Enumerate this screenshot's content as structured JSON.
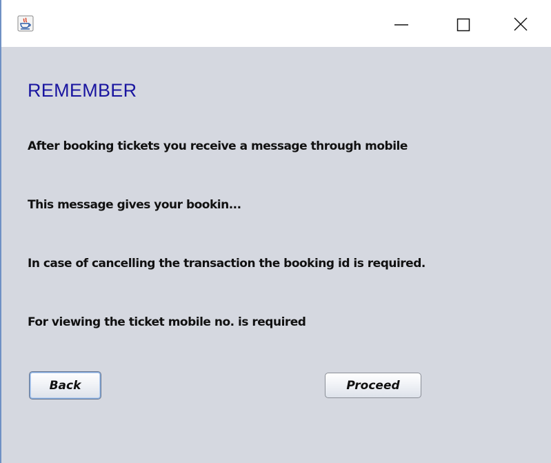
{
  "window": {
    "icon": "java-app-icon",
    "controls": {
      "minimize": "minimize-icon",
      "maximize": "maximize-icon",
      "close": "close-icon"
    }
  },
  "content": {
    "heading": "REMEMBER",
    "messages": [
      "After booking tickets you receive a message through mobile",
      "This message gives your bookin...",
      "In case of cancelling the transaction the booking id is required.",
      "For viewing the ticket mobile no. is required"
    ],
    "buttons": {
      "back_label": "Back",
      "proceed_label": "Proceed"
    }
  },
  "colors": {
    "heading": "#1a16a0",
    "background": "#d5d8e0",
    "titlebar": "#ffffff"
  }
}
